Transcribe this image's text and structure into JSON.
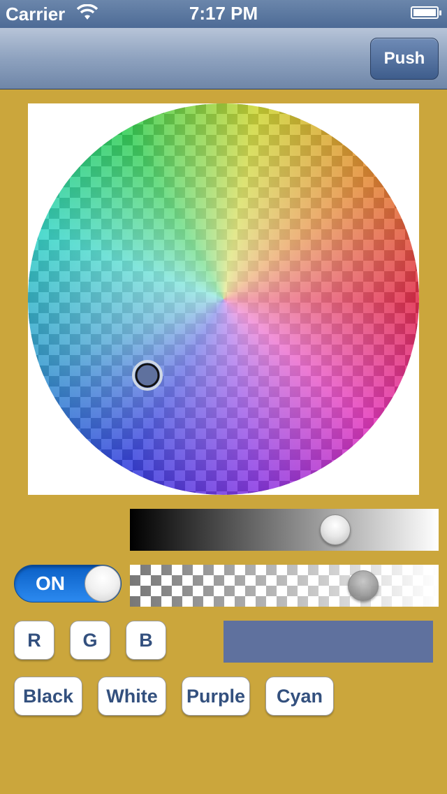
{
  "status_bar": {
    "carrier": "Carrier",
    "time": "7:17 PM",
    "wifi_icon": "wifi-icon",
    "battery_icon": "battery-icon"
  },
  "nav_bar": {
    "push_label": "Push"
  },
  "color_wheel": {
    "selected_color": "#5f719e",
    "checker_colors": [
      "#777777",
      "#ffffff"
    ]
  },
  "brightness_slider": {
    "value": 0.68
  },
  "alpha_slider": {
    "value": 0.78
  },
  "toggle": {
    "label": "ON",
    "state": "on",
    "color": "#1f7ae8"
  },
  "channel_buttons": [
    "R",
    "G",
    "B"
  ],
  "preset_buttons": [
    "Black",
    "White",
    "Purple",
    "Cyan"
  ],
  "swatch": {
    "color": "#5f719e"
  },
  "colors": {
    "background": "#cba63c",
    "nav_bar": "#8ea2bf",
    "button_text": "#33507e"
  }
}
